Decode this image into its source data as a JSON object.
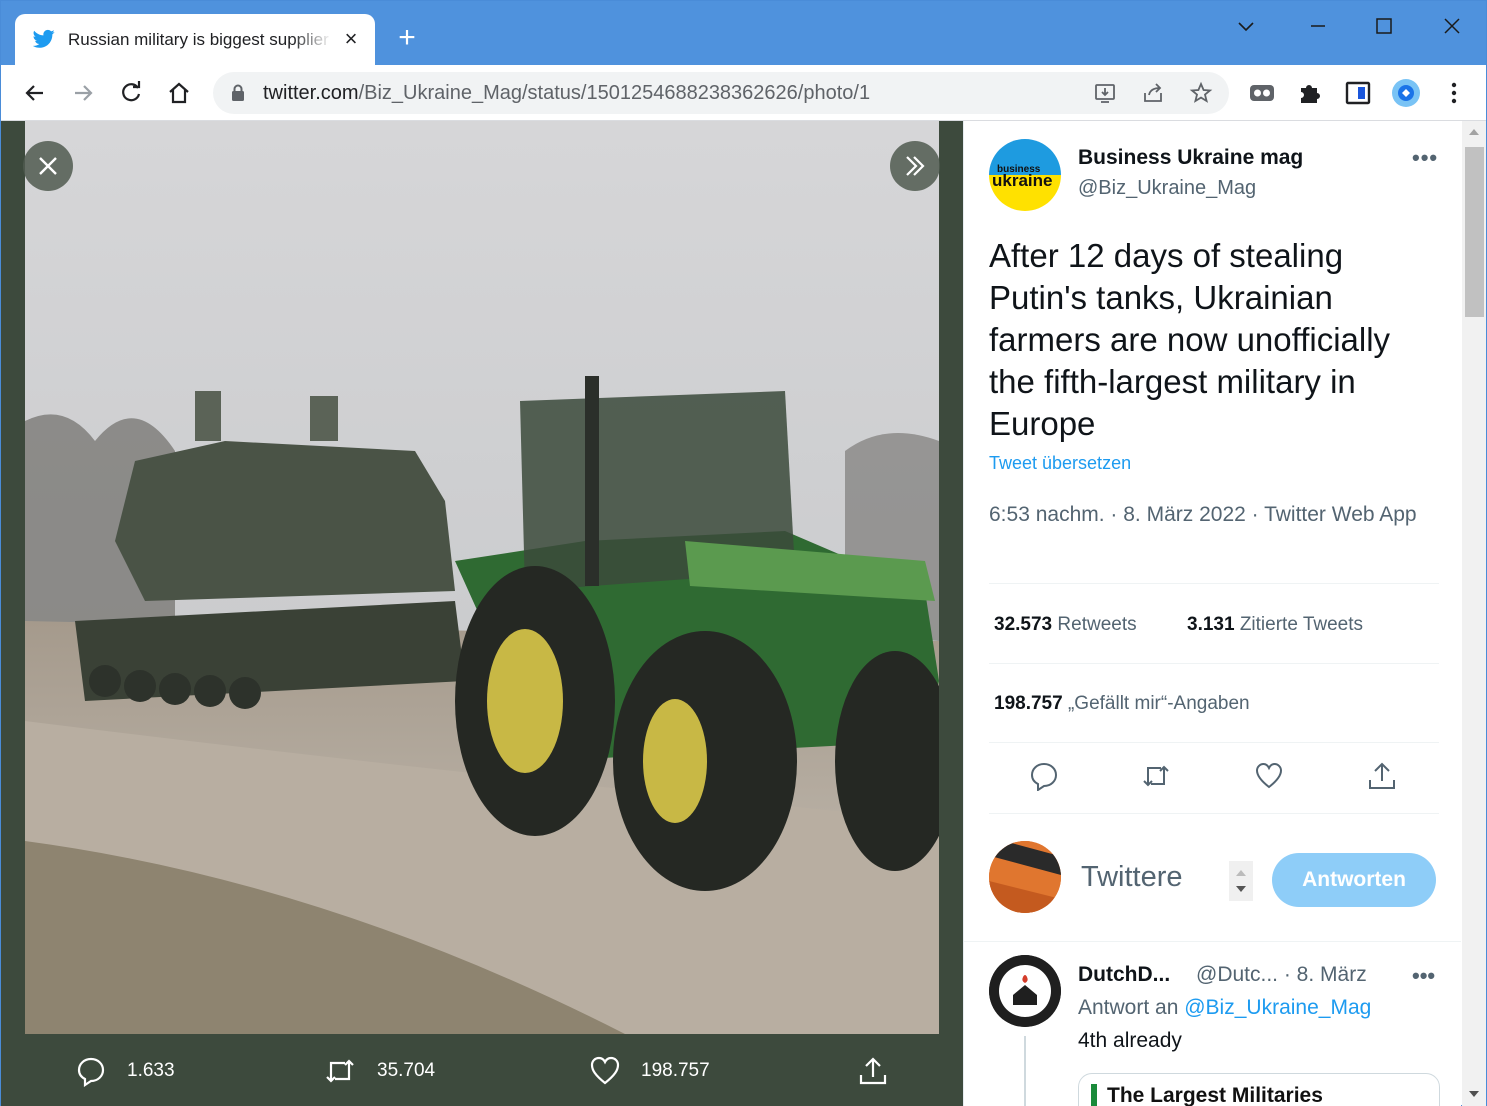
{
  "tab": {
    "title": "Russian military is biggest supplier of"
  },
  "toolbar": {
    "url_host": "twitter.com",
    "url_path": "/Biz_Ukraine_Mag/status/1501254688238362626/photo/1"
  },
  "media": {
    "reply_count": "1.633",
    "retweet_count": "35.704",
    "like_count": "198.757"
  },
  "tweet": {
    "author_name": "Business Ukraine mag",
    "author_handle": "@Biz_Ukraine_Mag",
    "text": "After 12 days of stealing Putin's tanks, Ukrainian farmers are now unofficially the fifth-largest military in Europe",
    "translate": "Tweet übersetzen",
    "meta": "6:53 nachm. · 8. März 2022 · Twitter Web App",
    "retweets_count": "32.573",
    "retweets_label": "Retweets",
    "quotes_count": "3.131",
    "quotes_label": "Zitierte Tweets",
    "likes_count": "198.757",
    "likes_label": "„Gefällt mir“-Angaben"
  },
  "compose": {
    "placeholder": "Twittere",
    "button": "Antworten"
  },
  "reply": {
    "name": "DutchD...",
    "handle": "@Dutc...",
    "date": "· 8. März",
    "reply_to_label": "Antwort an",
    "reply_to_handle": "@Biz_Ukraine_Mag",
    "text": "4th already",
    "card_title": "The Largest Militaries"
  },
  "avatar_text": {
    "line1": "business",
    "line2": "ukraine"
  },
  "colors": {
    "accent": "#1d9bf0",
    "titlebar": "#4f92dd",
    "viewer_bg": "#3d4a3d"
  }
}
